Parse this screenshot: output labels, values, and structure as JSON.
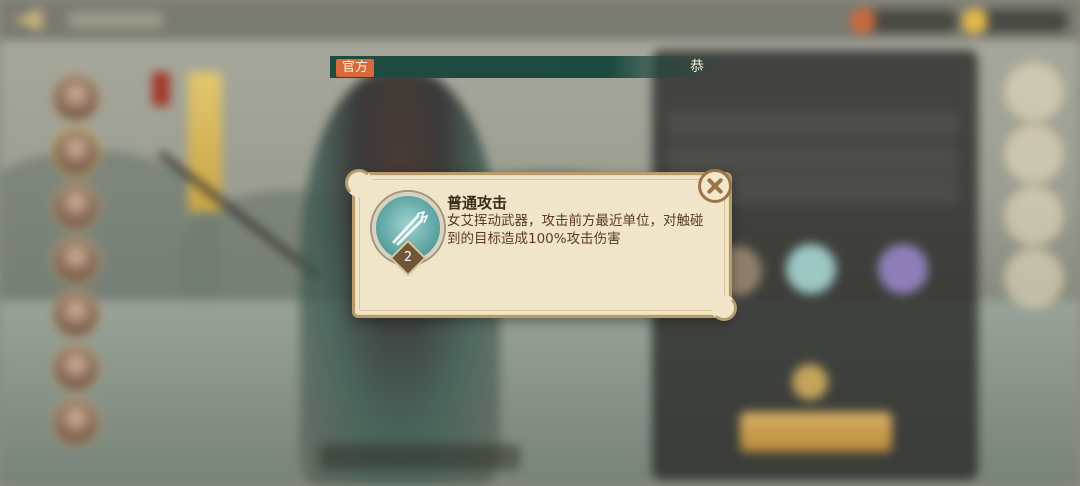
{
  "announcement": {
    "tag": "官方",
    "text": "恭"
  },
  "skill_tooltip": {
    "title": "普通攻击",
    "description": "女艾挥动武器，攻击前方最近单位，对触碰到的目标造成100%攻击伤害",
    "level": "2",
    "icon": "twin-blades-icon",
    "close_icon": "close-x-icon"
  },
  "colors": {
    "announcement_bar": "#1f4a40",
    "announcement_tag": "#d9683a",
    "tooltip_bg": "#f0e5c8",
    "tooltip_border": "#b89b6c",
    "title_text": "#3c2a1a",
    "desc_text": "#5b3b20"
  }
}
